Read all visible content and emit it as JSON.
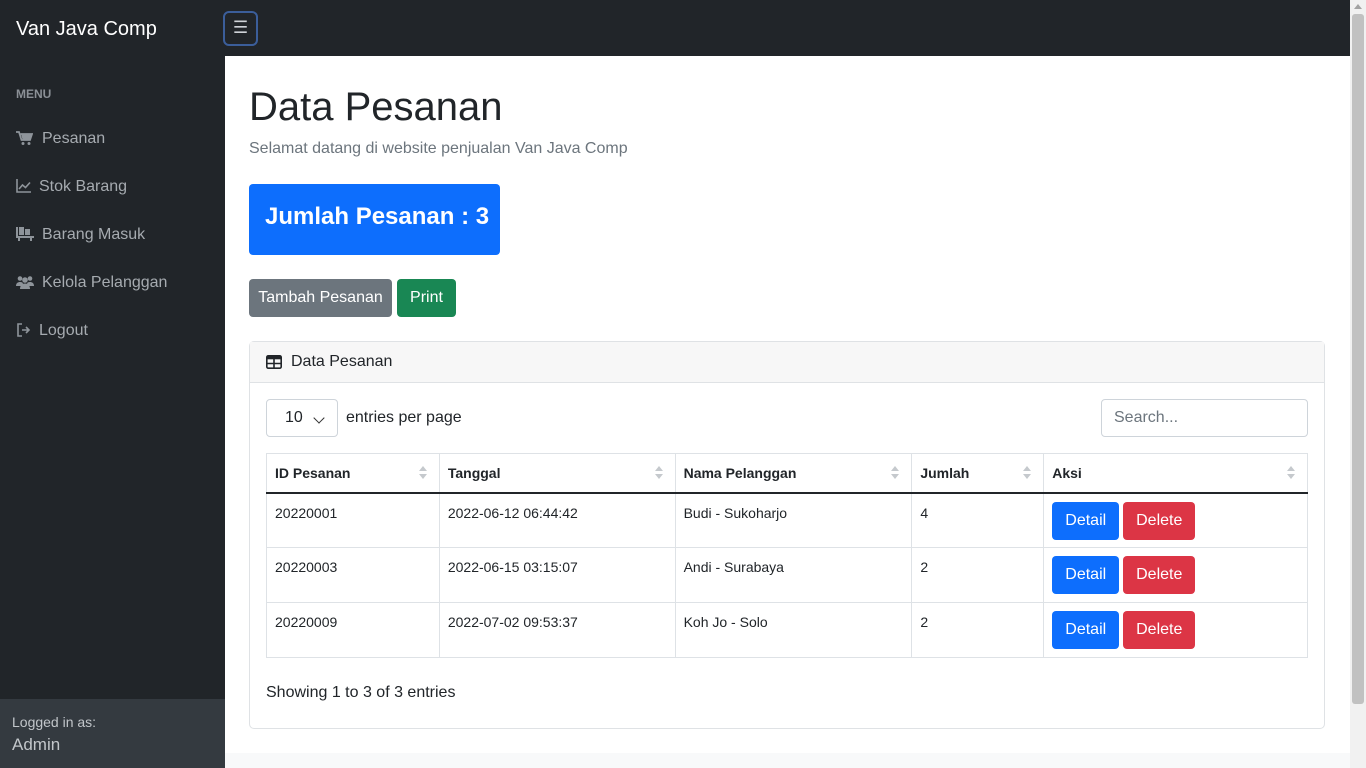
{
  "navbar": {
    "brand": "Van Java Comp",
    "toggle_icon": "☰"
  },
  "sidebar": {
    "heading": "MENU",
    "items": [
      {
        "label": "Pesanan",
        "icon": "cart-icon"
      },
      {
        "label": "Stok Barang",
        "icon": "chart-line-icon"
      },
      {
        "label": "Barang Masuk",
        "icon": "pallet-icon"
      },
      {
        "label": "Kelola Pelanggan",
        "icon": "users-icon"
      },
      {
        "label": "Logout",
        "icon": "sign-out-icon"
      }
    ],
    "footer": {
      "label": "Logged in as:",
      "user": "Admin"
    }
  },
  "main": {
    "title": "Data Pesanan",
    "subtitle": "Selamat datang di website penjualan Van Java Comp",
    "count_card": "Jumlah Pesanan : 3",
    "add_button": "Tambah Pesanan",
    "print_button": "Print",
    "card": {
      "header": "Data Pesanan",
      "per_page_value": "10",
      "per_page_label": "entries per page",
      "search_placeholder": "Search...",
      "columns": [
        "ID Pesanan",
        "Tanggal",
        "Nama Pelanggan",
        "Jumlah",
        "Aksi"
      ],
      "rows": [
        {
          "id": "20220001",
          "tanggal": "2022-06-12 06:44:42",
          "nama": "Budi - Sukoharjo",
          "jumlah": "4"
        },
        {
          "id": "20220003",
          "tanggal": "2022-06-15 03:15:07",
          "nama": "Andi - Surabaya",
          "jumlah": "2"
        },
        {
          "id": "20220009",
          "tanggal": "2022-07-02 09:53:37",
          "nama": "Koh Jo - Solo",
          "jumlah": "2"
        }
      ],
      "detail_label": "Detail",
      "delete_label": "Delete",
      "showing": "Showing 1 to 3 of 3 entries"
    }
  },
  "colors": {
    "dark": "#212529",
    "primary": "#0d6efd",
    "secondary": "#6c757d",
    "success": "#198754",
    "danger": "#dc3545"
  }
}
